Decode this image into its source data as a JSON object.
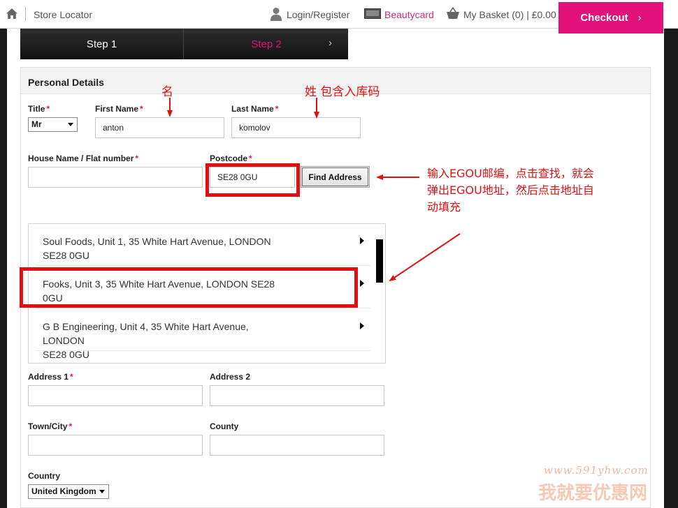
{
  "topbar": {
    "store_locator": "Store Locator",
    "login": "Login/Register",
    "beautycard": "Beautycard",
    "basket": "My Basket (0) | £0.00",
    "checkout": "Checkout",
    "checkout_chevron": "›"
  },
  "steps": {
    "step1": "Step 1",
    "step2": "Step 2",
    "step2_chevron": "›"
  },
  "section": {
    "title": "Personal Details"
  },
  "form": {
    "title_label": "Title",
    "title_value": "Mr",
    "first_name_label": "First Name",
    "first_name_value": "anton",
    "last_name_label": "Last Name",
    "last_name_value": "komolov",
    "house_label": "House Name / Flat number",
    "house_value": "",
    "postcode_label": "Postcode",
    "postcode_value": "SE28 0GU",
    "find_address": "Find Address",
    "address1_label": "Address 1",
    "address2_label": "Address 2",
    "town_label": "Town/City",
    "county_label": "County",
    "country_label": "Country",
    "country_value": "United Kingdom",
    "required_mark": "*"
  },
  "addresses": [
    {
      "line1": "Soul Foods, Unit 1, 35 White Hart Avenue, LONDON",
      "line2": "SE28 0GU"
    },
    {
      "line1": "Fooks, Unit 3, 35 White Hart Avenue, LONDON SE28",
      "line2": "0GU"
    },
    {
      "line1": "G B Engineering, Unit 4, 35 White Hart Avenue, LONDON",
      "line2": "SE28 0GU"
    }
  ],
  "annotations": {
    "first_name_note": "名",
    "last_name_note": "姓 包含入库码",
    "postcode_note_line1": "输入EGOU邮编，点击查找，就会",
    "postcode_note_line2": "弹出EGOU地址，然后点击地址自",
    "postcode_note_line3": "动填充"
  },
  "watermark": {
    "url": "www.591yhw.com",
    "name": "我就要优惠网"
  },
  "colors": {
    "accent": "#e2127a",
    "annotation_red": "#e01010"
  }
}
